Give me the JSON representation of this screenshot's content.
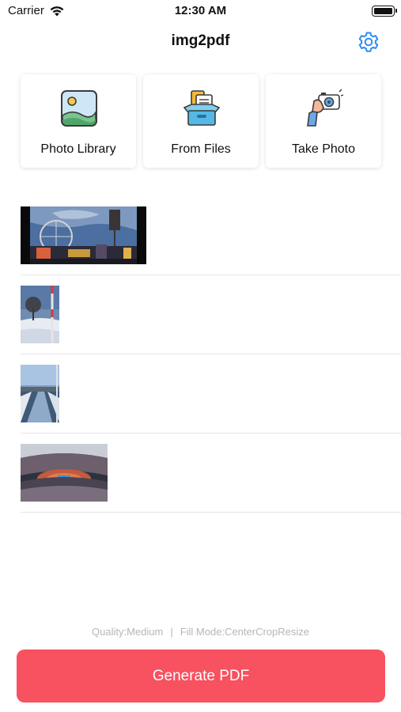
{
  "status_bar": {
    "carrier": "Carrier",
    "time": "12:30 AM",
    "wifi_icon": "wifi-icon",
    "battery_icon": "battery-icon"
  },
  "nav": {
    "title": "img2pdf",
    "settings_icon": "gear-icon"
  },
  "sources": [
    {
      "label": "Photo Library",
      "icon": "photo-library-icon"
    },
    {
      "label": "From Files",
      "icon": "file-box-icon"
    },
    {
      "label": "Take Photo",
      "icon": "camera-hand-icon"
    }
  ],
  "images": [
    {
      "description_icon": "city-skyline-thumbnail"
    },
    {
      "description_icon": "snowy-tree-thumbnail"
    },
    {
      "description_icon": "snowy-road-thumbnail"
    },
    {
      "description_icon": "stadium-thumbnail"
    }
  ],
  "footer": {
    "quality": "Quality:Medium",
    "separator": "|",
    "fill_mode": "Fill Mode:CenterCropResize",
    "generate_label": "Generate PDF"
  },
  "colors": {
    "accent": "#2f8df0",
    "generate_button": "#f8515f",
    "summary_text": "#b6b6b6"
  }
}
